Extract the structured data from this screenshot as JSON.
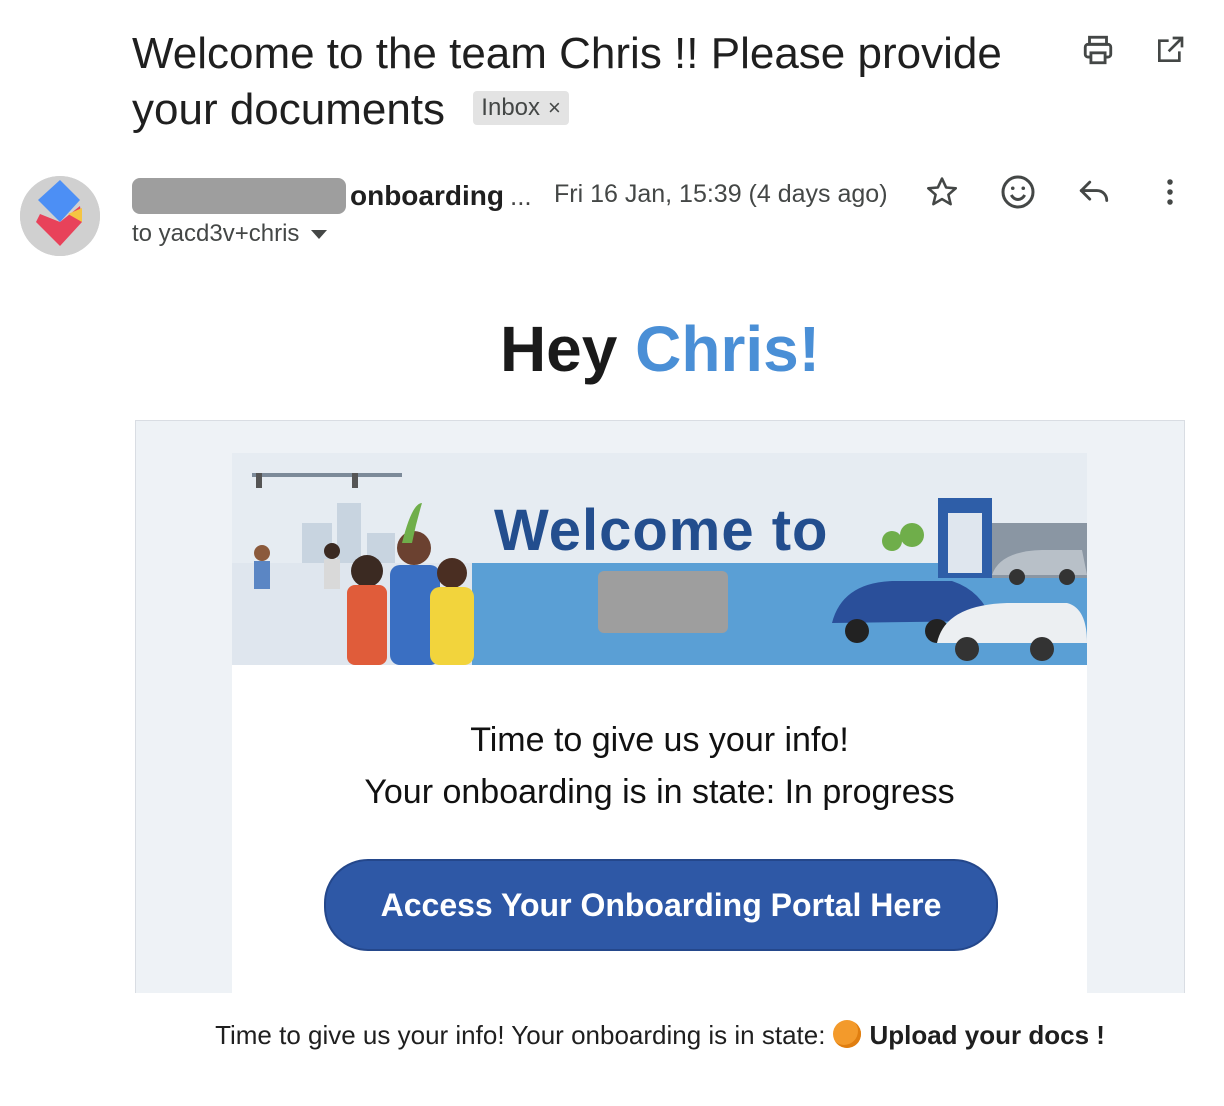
{
  "subject": {
    "text": "Welcome to the team Chris !! Please provide your documents",
    "label": "Inbox",
    "label_remove": "×"
  },
  "toolbar": {
    "print_icon": "print-icon",
    "open_icon": "open-in-new-window-icon"
  },
  "sender": {
    "name": "onboarding",
    "ellipsis": "...",
    "to": "to yacd3v+chris",
    "date": "Fri 16 Jan, 15:39 (4 days ago)"
  },
  "message_actions": [
    "star-icon",
    "emoji-icon",
    "reply-icon",
    "more-vertical-icon"
  ],
  "greeting": {
    "hey": "Hey",
    "name": "Chris!",
    "name_color": "#4a8fd6"
  },
  "banner": {
    "title": "Welcome to"
  },
  "card": {
    "line1": "Time to give us your info!",
    "line2": "Your onboarding is in state: In progress",
    "button": "Access Your Onboarding Portal Here",
    "button_color": "#2e58a6"
  },
  "footer": {
    "text": "Time to give us your info! Your onboarding is in state:",
    "status_color": "#f39a2b",
    "cta": "Upload your docs !"
  }
}
